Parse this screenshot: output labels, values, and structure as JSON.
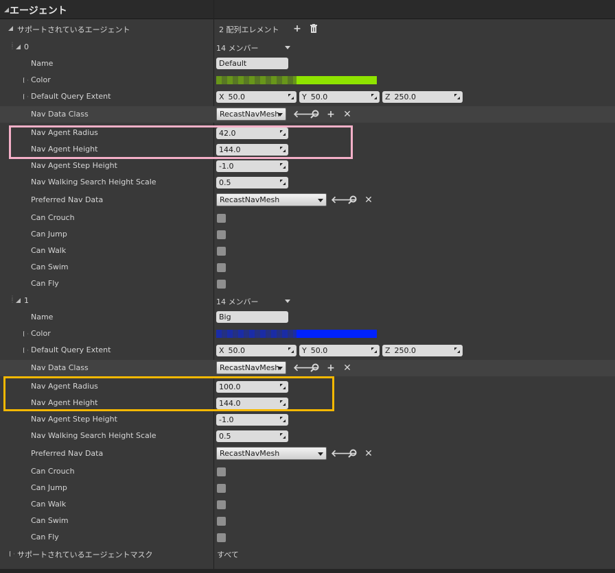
{
  "header": {
    "title": "エージェント"
  },
  "supported_agents": {
    "label": "サポートされているエージェント",
    "array_summary": "2 配列エレメント",
    "add_icon": "plus-icon",
    "delete_icon": "trash-icon"
  },
  "agents": [
    {
      "index": "0",
      "members": "14 メンバー",
      "name_label": "Name",
      "name": "Default",
      "color_label": "Color",
      "color": "#8fe300",
      "extent_label": "Default Query Extent",
      "extent_x_axis": "X",
      "extent_x": "50.0",
      "extent_y_axis": "Y",
      "extent_y": "50.0",
      "extent_z_axis": "Z",
      "extent_z": "250.0",
      "nav_data_class_label": "Nav Data Class",
      "nav_data_class": "RecastNavMesh",
      "radius_label": "Nav Agent Radius",
      "radius": "42.0",
      "height_label": "Nav Agent Height",
      "height": "144.0",
      "step_label": "Nav Agent Step Height",
      "step": "-1.0",
      "search_scale_label": "Nav Walking Search Height Scale",
      "search_scale": "0.5",
      "preferred_label": "Preferred Nav Data",
      "preferred": "RecastNavMesh",
      "crouch_label": "Can Crouch",
      "jump_label": "Can Jump",
      "walk_label": "Can Walk",
      "swim_label": "Can Swim",
      "fly_label": "Can Fly",
      "highlight_color": "#f5b0c8"
    },
    {
      "index": "1",
      "members": "14 メンバー",
      "name_label": "Name",
      "name": "Big",
      "color_label": "Color",
      "color": "#0022ff",
      "extent_label": "Default Query Extent",
      "extent_x_axis": "X",
      "extent_x": "50.0",
      "extent_y_axis": "Y",
      "extent_y": "50.0",
      "extent_z_axis": "Z",
      "extent_z": "250.0",
      "nav_data_class_label": "Nav Data Class",
      "nav_data_class": "RecastNavMesh",
      "radius_label": "Nav Agent Radius",
      "radius": "100.0",
      "height_label": "Nav Agent Height",
      "height": "144.0",
      "step_label": "Nav Agent Step Height",
      "step": "-1.0",
      "search_scale_label": "Nav Walking Search Height Scale",
      "search_scale": "0.5",
      "preferred_label": "Preferred Nav Data",
      "preferred": "RecastNavMesh",
      "crouch_label": "Can Crouch",
      "jump_label": "Can Jump",
      "walk_label": "Can Walk",
      "swim_label": "Can Swim",
      "fly_label": "Can Fly",
      "highlight_color": "#f5b800"
    }
  ],
  "mask": {
    "label": "サポートされているエージェントマスク",
    "value": "すべて"
  }
}
